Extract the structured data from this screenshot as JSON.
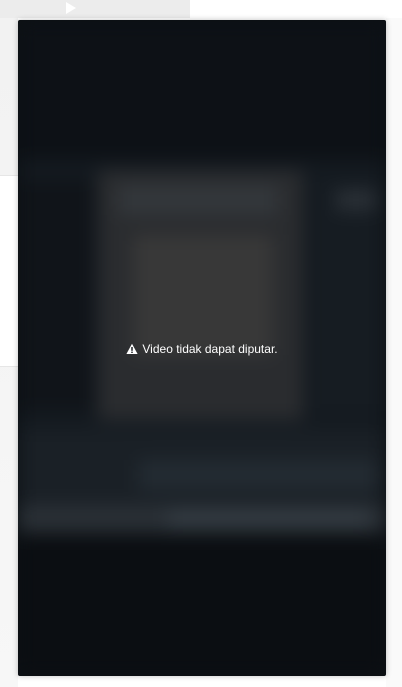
{
  "background": {
    "icons": [
      "play-icon"
    ]
  },
  "player": {
    "background_color": "#0c1014",
    "message": "Video tidak dapat diputar.",
    "message_icon": "warning-icon"
  }
}
